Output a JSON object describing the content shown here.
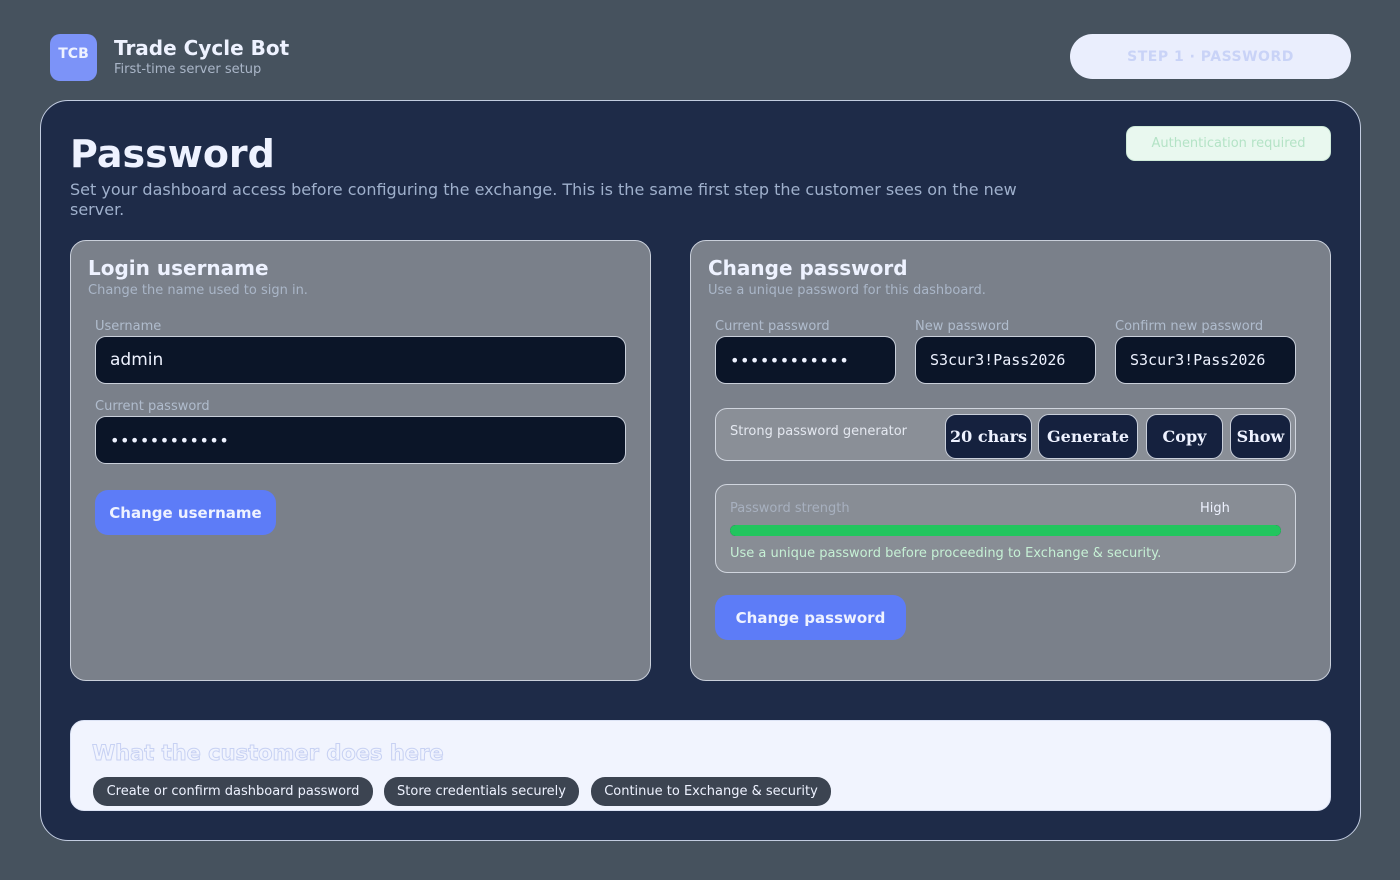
{
  "header": {
    "logo_text": "TCB",
    "app_title": "Trade Cycle Bot",
    "app_subtitle": "First-time server setup",
    "step_label": "STEP 1 · PASSWORD"
  },
  "page": {
    "title": "Password",
    "description": "Set your dashboard access before configuring the exchange. This is the same first step the customer sees on the new server.",
    "auth_badge": "Authentication required"
  },
  "login_panel": {
    "title": "Login username",
    "subtitle": "Change the name used to sign in.",
    "username_label": "Username",
    "username_value": "admin",
    "current_password_label": "Current password",
    "current_password_value": "••••••••••••",
    "submit_label": "Change username"
  },
  "password_panel": {
    "title": "Change password",
    "subtitle": "Use a unique password for this dashboard.",
    "current_password_label": "Current password",
    "current_password_value": "••••••••••••",
    "new_password_label": "New password",
    "new_password_value": "S3cur3!Pass2026",
    "confirm_password_label": "Confirm new password",
    "confirm_password_value": "S3cur3!Pass2026",
    "generator": {
      "label": "Strong password generator",
      "length_button": "20 chars",
      "generate_button": "Generate",
      "copy_button": "Copy",
      "show_button": "Show"
    },
    "strength": {
      "label": "Password strength",
      "value": "High",
      "level_percent": 100,
      "note": "Use a unique password before proceeding to Exchange & security."
    },
    "submit_label": "Change password"
  },
  "customer_steps": {
    "title": "What the customer does here",
    "chips": [
      "Create or confirm dashboard password",
      "Store credentials securely",
      "Continue to Exchange & security"
    ]
  },
  "colors": {
    "background": "#46525e",
    "card": "#1e2b48",
    "accent": "#5d7cf7",
    "strength_fill": "#22c55e"
  }
}
